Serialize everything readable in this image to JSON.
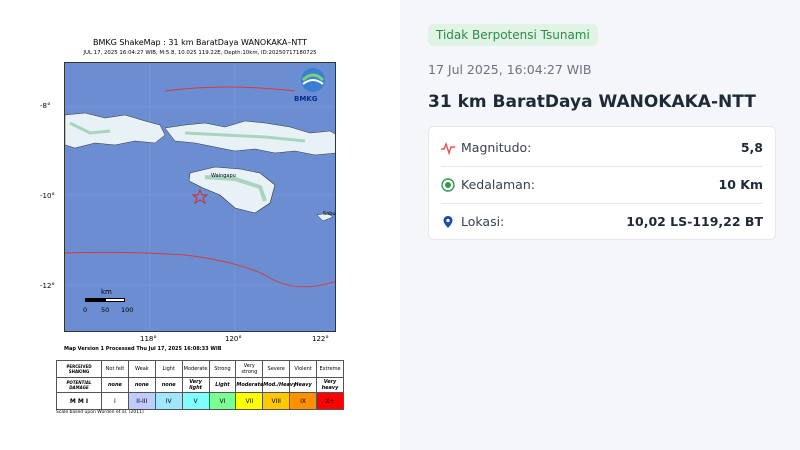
{
  "shakemap": {
    "title": "BMKG ShakeMap : 31 km BaratDaya WANOKAKA–NTT",
    "subtitle": "JUL 17, 2025 16:04:27 WIB, M:5.8, 10.025 119.22E, Depth:10km, ID:20250717180725",
    "logo_text": "BMKG",
    "lat_labels": [
      "-8°",
      "-10°",
      "-12°"
    ],
    "lon_labels": [
      "118°",
      "120°",
      "122°"
    ],
    "place_labels": [
      "Waingapu",
      "Sabu"
    ],
    "scale": {
      "unit": "km",
      "ticks": [
        "0",
        "50",
        "100"
      ]
    },
    "version_text": "Map Version 1 Processed Thu Jul 17, 2025 16:08:33 WIB",
    "footnote": "Scale based upon Worden et al. (2011)",
    "mmi_table": {
      "row_headers": [
        "PERCEIVED SHAKING",
        "POTENTIAL DAMAGE",
        "M M I"
      ],
      "shaking": [
        "Not felt",
        "Weak",
        "Light",
        "Moderate",
        "Strong",
        "Very strong",
        "Severe",
        "Violent",
        "Extreme"
      ],
      "damage": [
        "none",
        "none",
        "none",
        "Very light",
        "Light",
        "Moderate",
        "Mod./Heavy",
        "Heavy",
        "Very heavy"
      ],
      "mmi": [
        "I",
        "II-III",
        "IV",
        "V",
        "VI",
        "VII",
        "VIII",
        "IX",
        "X+"
      ],
      "colors": [
        "#ffffff",
        "#bfccff",
        "#a0e6ff",
        "#80ffff",
        "#7aff93",
        "#ffff00",
        "#ffc800",
        "#ff9100",
        "#ff0000"
      ]
    }
  },
  "info": {
    "tsunami_status": "Tidak Berpotensi Tsunami",
    "datetime": "17 Jul 2025, 16:04:27 WIB",
    "location_title": "31 km BaratDaya WANOKAKA-NTT",
    "details": [
      {
        "label": "Magnitudo:",
        "value": "5,8",
        "icon": "pulse-icon",
        "color": "#e05252"
      },
      {
        "label": "Kedalaman:",
        "value": "10 Km",
        "icon": "target-icon",
        "color": "#2f9a4a"
      },
      {
        "label": "Lokasi:",
        "value": "10,02 LS-119,22 BT",
        "icon": "location-pin-icon",
        "color": "#1e4fa8"
      }
    ]
  }
}
